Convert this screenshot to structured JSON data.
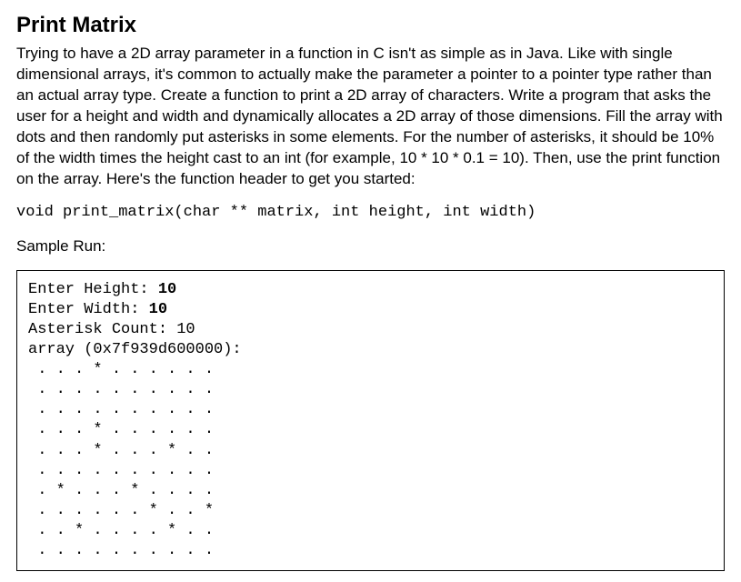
{
  "title": "Print Matrix",
  "description": "Trying to have a 2D array parameter in a function in C isn't as simple as in Java. Like with single dimensional arrays, it's common to actually make the parameter a pointer to a pointer type rather than an actual array type. Create a function to print a 2D array of characters. Write a program that asks the user for a height and width and dynamically allocates a 2D array of those dimensions. Fill the array with dots and then randomly put asterisks in some elements. For the number of asterisks, it should be 10% of the width times the height cast to an int (for example, 10 * 10 * 0.1 = 10). Then, use the print function on the array. Here's the function header to get you started:",
  "function_header": "void print_matrix(char ** matrix, int height, int width)",
  "sample_run_label": "Sample Run:",
  "sample": {
    "prompt_height_label": "Enter Height: ",
    "prompt_height_value": "10",
    "prompt_width_label": "Enter Width: ",
    "prompt_width_value": "10",
    "asterisk_line": "Asterisk Count: 10",
    "array_line": "array (0x7f939d600000):",
    "matrix_rows": [
      " . . . * . . . . . .",
      " . . . . . . . . . .",
      " . . . . . . . . . .",
      " . . . * . . . . . .",
      " . . . * . . . * . .",
      " . . . . . . . . . .",
      " . * . . . * . . . .",
      " . . . . . . * . . *",
      " . . * . . . . * . .",
      " . . . . . . . . . ."
    ]
  }
}
